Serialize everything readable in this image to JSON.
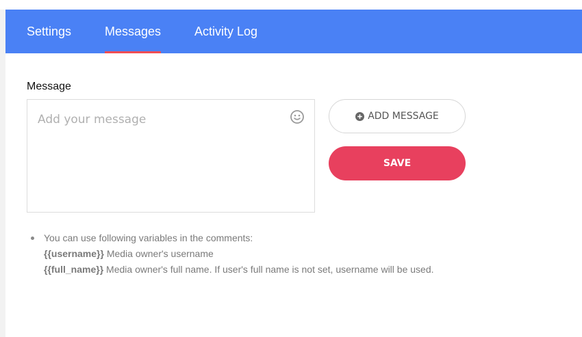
{
  "tabs": [
    {
      "label": "Settings",
      "active": false
    },
    {
      "label": "Messages",
      "active": true
    },
    {
      "label": "Activity Log",
      "active": false
    }
  ],
  "message": {
    "label": "Message",
    "placeholder": "Add your message",
    "value": ""
  },
  "buttons": {
    "add_message": "ADD MESSAGE",
    "save": "SAVE"
  },
  "help": {
    "intro": "You can use following variables in the comments:",
    "variables": [
      {
        "name": "{{username}}",
        "description": " Media owner's username"
      },
      {
        "name": "{{full_name}}",
        "description": " Media owner's full name. If user's full name is not set, username will be used."
      }
    ]
  },
  "icons": {
    "emoji": "smiley-face-icon",
    "add": "plus-circle-icon"
  },
  "colors": {
    "tabbar": "#4a81f5",
    "active_underline": "#f04e53",
    "save_button": "#e8405e"
  }
}
